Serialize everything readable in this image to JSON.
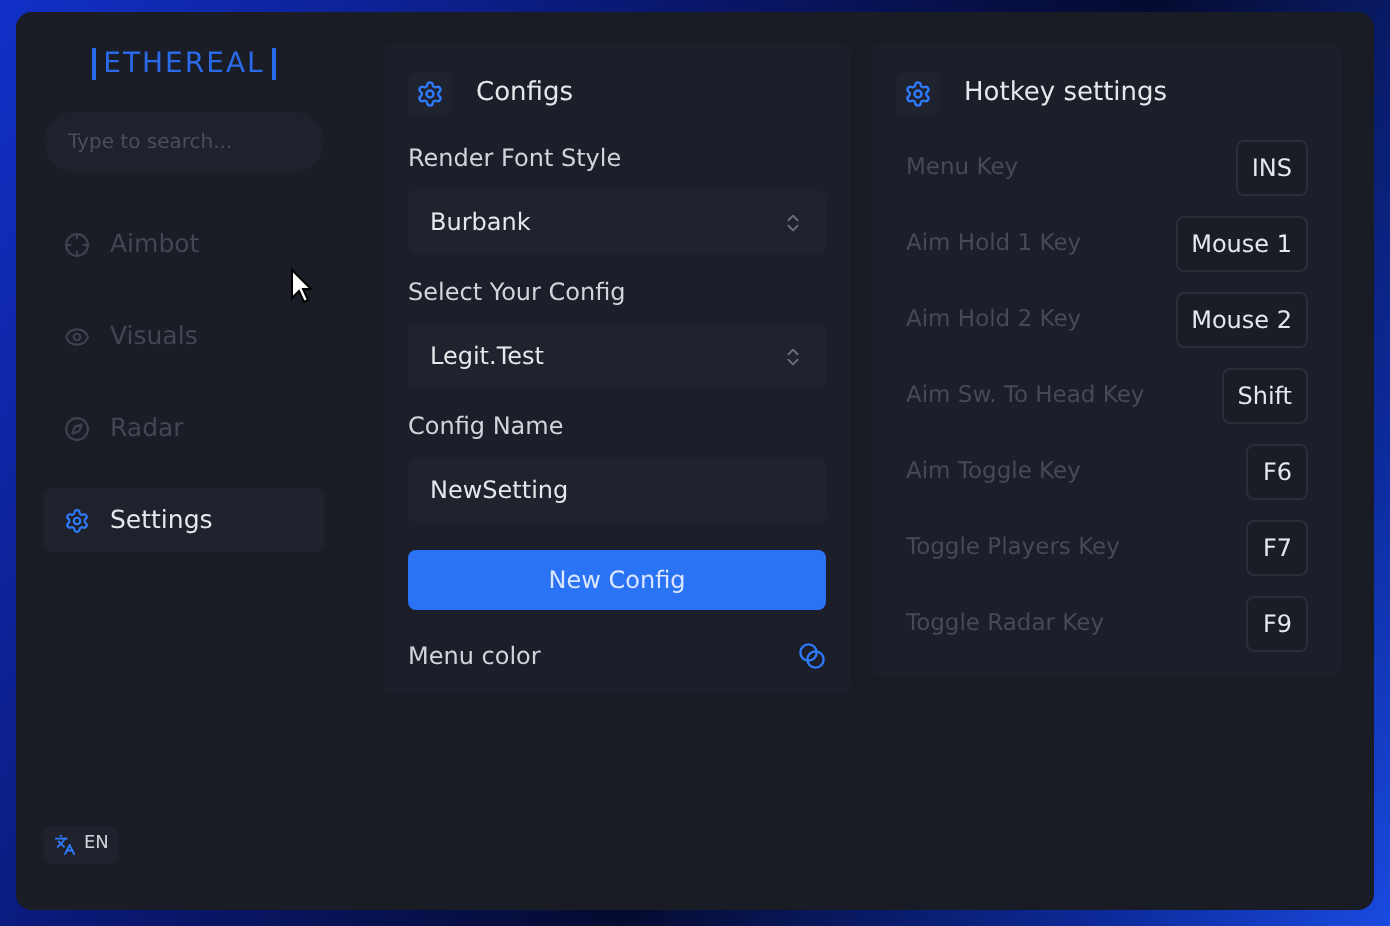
{
  "logo": "ETHEREAL",
  "search": {
    "placeholder": "Type to search..."
  },
  "nav": [
    {
      "label": "Aimbot",
      "kind": "crosshair",
      "selected": false
    },
    {
      "label": "Visuals",
      "kind": "eye",
      "selected": false
    },
    {
      "label": "Radar",
      "kind": "compass",
      "selected": false
    },
    {
      "label": "Settings",
      "kind": "gear",
      "selected": true
    }
  ],
  "language": "EN",
  "configs": {
    "title": "Configs",
    "fields": [
      {
        "kind": "select",
        "label": "Render Font Style",
        "value": "Burbank"
      },
      {
        "kind": "select",
        "label": "Select Your Config",
        "value": "Legit.Test"
      },
      {
        "kind": "input",
        "label": "Config Name",
        "value": "NewSetting"
      }
    ],
    "button": "New Config",
    "menu_color": "Menu color"
  },
  "hotkeys": {
    "title": "Hotkey settings",
    "rows": [
      {
        "label": "Menu Key",
        "key": "INS"
      },
      {
        "label": "Aim Hold 1 Key",
        "key": "Mouse 1"
      },
      {
        "label": "Aim Hold 2 Key",
        "key": "Mouse 2"
      },
      {
        "label": "Aim Sw. To Head Key",
        "key": "Shift"
      },
      {
        "label": "Aim Toggle Key",
        "key": "F6"
      },
      {
        "label": "Toggle Players Key",
        "key": "F7"
      },
      {
        "label": "Toggle Radar Key",
        "key": "F9"
      }
    ]
  }
}
